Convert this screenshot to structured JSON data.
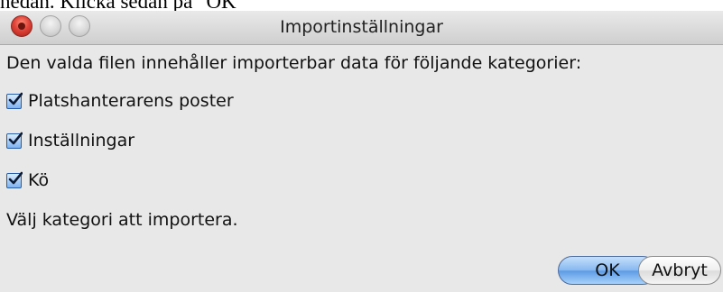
{
  "background_document": {
    "text": "nedan. Klicka sedan på \"OK\""
  },
  "dialog": {
    "title": "Importinställningar",
    "intro_text": "Den valda filen innehåller importerbar data för följande kategorier:",
    "categories": [
      {
        "label": "Platshanterarens poster",
        "checked": true
      },
      {
        "label": "Inställningar",
        "checked": true
      },
      {
        "label": "Kö",
        "checked": true
      }
    ],
    "instruction_text": "Välj kategori att importera.",
    "buttons": {
      "ok_label": "OK",
      "cancel_label": "Avbryt"
    }
  },
  "window_controls": [
    "close-icon",
    "minimize-icon",
    "zoom-icon"
  ],
  "colors": {
    "close": "#e0443a",
    "default_button": "#5d9be4",
    "checkbox": "#7fb3f0",
    "dialog_background": "#e8e8e8"
  }
}
